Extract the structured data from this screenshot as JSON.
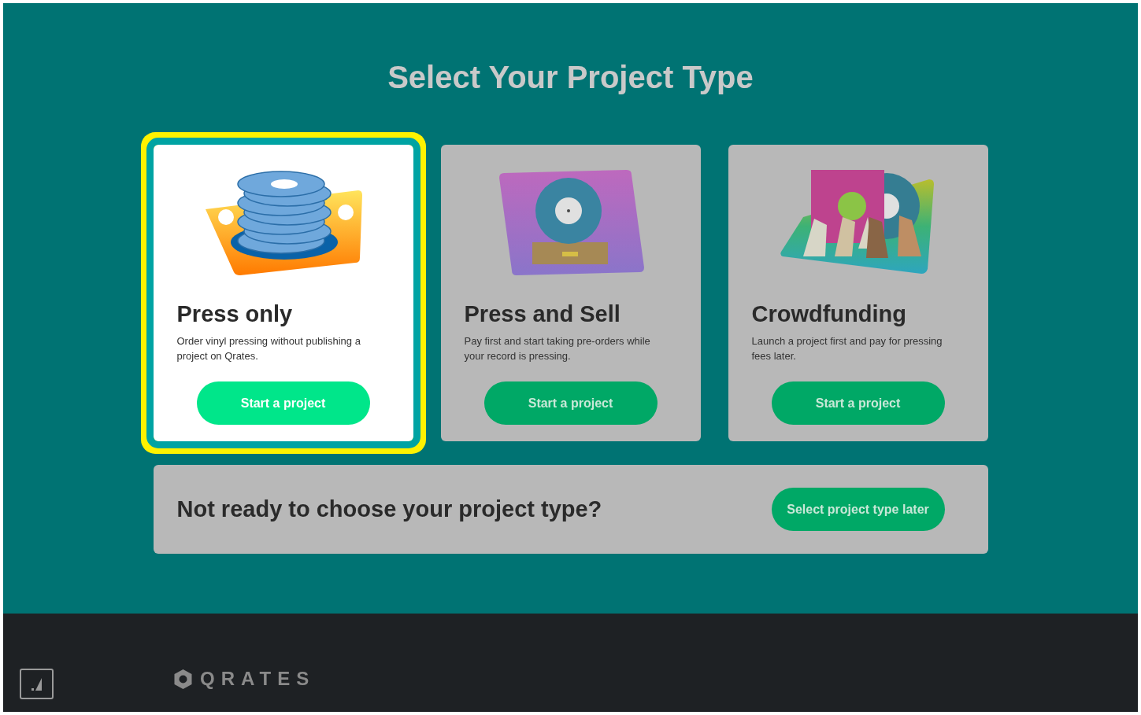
{
  "title": "Select Your Project Type",
  "cards": [
    {
      "kind": "press",
      "title": "Press only",
      "description": "Order vinyl pressing without publishing a project on Qrates.",
      "button": "Start a project",
      "selected": true
    },
    {
      "kind": "sell",
      "title": "Press and Sell",
      "description": "Pay first and start taking pre-orders while your record is pressing.",
      "button": "Start a project",
      "selected": false
    },
    {
      "kind": "crowd",
      "title": "Crowdfunding",
      "description": "Launch a project first and pay for pressing fees later.",
      "button": "Start a project",
      "selected": false
    }
  ],
  "later": {
    "text": "Not ready to choose your project type?",
    "button": "Select project type later"
  },
  "footer": {
    "logo": "QRATES"
  }
}
